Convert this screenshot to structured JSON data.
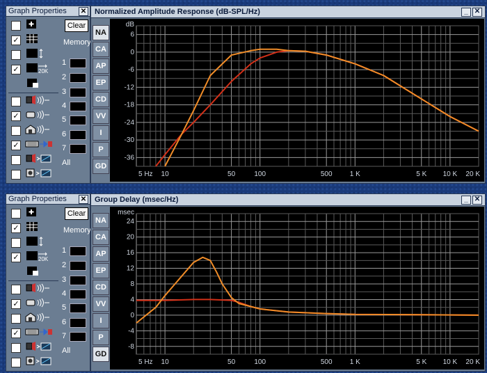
{
  "graph_properties": {
    "title": "Graph Properties",
    "close": "✕",
    "clear_label": "Clear",
    "memory_label": "Memory",
    "memory_slots": [
      "1",
      "2",
      "3",
      "4",
      "5",
      "6",
      "7"
    ],
    "memory_all": "All",
    "checkbox_states": [
      false,
      true,
      false,
      true,
      false,
      true,
      false,
      true,
      false,
      false,
      false
    ]
  },
  "tabs": [
    "NA",
    "CA",
    "AP",
    "EP",
    "CD",
    "VV",
    "I",
    "P",
    "GD"
  ],
  "window_buttons": {
    "minimize": "_",
    "close": "✕"
  },
  "charts": [
    {
      "title": "Normalized Amplitude Response (dB-SPL/Hz)",
      "active_tab": "NA",
      "unit": "dB",
      "yticks": [
        "6",
        "0",
        "-6",
        "-12",
        "-18",
        "-24",
        "-30",
        "-36"
      ],
      "xticks": [
        "5 Hz",
        "10",
        "50",
        "100",
        "500",
        "1 K",
        "5 K",
        "10 K",
        "20 K"
      ]
    },
    {
      "title": "Group Delay (msec/Hz)",
      "active_tab": "GD",
      "unit": "msec",
      "yticks": [
        "24",
        "20",
        "16",
        "12",
        "8",
        "4",
        "0",
        "-4",
        "-8"
      ],
      "xticks": [
        "5 Hz",
        "10",
        "50",
        "100",
        "500",
        "1 K",
        "5 K",
        "10 K",
        "20 K"
      ]
    }
  ],
  "chart_data": [
    {
      "type": "line",
      "title": "Normalized Amplitude Response (dB-SPL/Hz)",
      "ylabel": "dB",
      "xscale": "log",
      "xlim": [
        5,
        20000
      ],
      "ylim": [
        -39,
        9
      ],
      "colors": {
        "series1": "#d23018",
        "series2": "#f08c28"
      },
      "series": [
        {
          "x": [
            8,
            10,
            15,
            20,
            30,
            50,
            80,
            100,
            150,
            200,
            300,
            500,
            1000,
            2000,
            5000,
            10000,
            20000
          ],
          "y": [
            -39,
            -35,
            -28,
            -24,
            -18,
            -10,
            -4,
            -2,
            0,
            0.5,
            0.3,
            -1,
            -4,
            -8,
            -16,
            -22,
            -27
          ]
        },
        {
          "x": [
            10,
            15,
            20,
            30,
            50,
            80,
            100,
            150,
            200,
            300,
            500,
            1000,
            2000,
            5000,
            10000,
            20000
          ],
          "y": [
            -39,
            -28,
            -20,
            -8,
            -1,
            0.5,
            1,
            1,
            0.5,
            0.3,
            -1,
            -4,
            -8,
            -16,
            -22,
            -27
          ]
        }
      ]
    },
    {
      "type": "line",
      "title": "Group Delay (msec/Hz)",
      "ylabel": "msec",
      "xscale": "log",
      "xlim": [
        5,
        20000
      ],
      "ylim": [
        -10,
        26
      ],
      "colors": {
        "series1": "#d23018",
        "series2": "#f08c28"
      },
      "series": [
        {
          "x": [
            5,
            10,
            20,
            30,
            50,
            60,
            80,
            100,
            200,
            500,
            1000,
            5000,
            20000
          ],
          "y": [
            3.8,
            3.8,
            4,
            4,
            3.8,
            3.3,
            2.2,
            1.6,
            0.8,
            0.4,
            0.2,
            0.1,
            0
          ]
        },
        {
          "x": [
            5,
            8,
            10,
            15,
            20,
            25,
            30,
            35,
            40,
            50,
            60,
            80,
            100,
            200,
            500,
            1000,
            5000,
            20000
          ],
          "y": [
            -2,
            2,
            5,
            10,
            13.5,
            14.8,
            14,
            11,
            8,
            4.5,
            3,
            2.2,
            1.6,
            0.8,
            0.4,
            0.2,
            0.1,
            0
          ]
        }
      ]
    }
  ]
}
